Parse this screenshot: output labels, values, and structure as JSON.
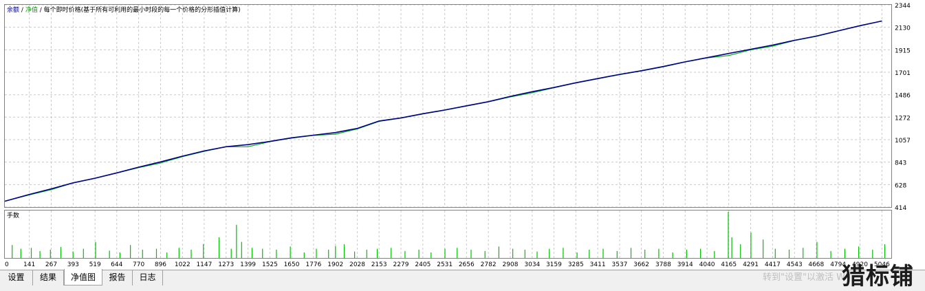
{
  "legend": {
    "balance": "余额",
    "sep1": "/",
    "equity": "净值",
    "sep2": "/",
    "description": "每个即时价格(基于所有可利用的最小时段的每一个价格的分形插值计算)"
  },
  "volume_panel_label": "手数",
  "tabs": [
    {
      "label": "设置",
      "active": false
    },
    {
      "label": "结果",
      "active": false
    },
    {
      "label": "净值图",
      "active": true
    },
    {
      "label": "报告",
      "active": false
    },
    {
      "label": "日志",
      "active": false
    }
  ],
  "watermark": {
    "text": "转到\"设置\"以激活 W",
    "logo": "猎标铺"
  },
  "colors": {
    "balance_line": "#00008b",
    "equity_line": "#00aa00",
    "volume_bars": "#00c000",
    "grid": "#c8c8c8"
  },
  "chart_data": [
    {
      "type": "line",
      "series": [
        {
          "name": "余额",
          "x": [
            0,
            141,
            267,
            393,
            519,
            644,
            770,
            896,
            1022,
            1147,
            1273,
            1399,
            1525,
            1650,
            1776,
            1902,
            2028,
            2153,
            2279,
            2405,
            2531,
            2656,
            2782,
            2908,
            3034,
            3159,
            3285,
            3411,
            3537,
            3662,
            3788,
            3914,
            4040,
            4165,
            4291,
            4417,
            4543,
            4668,
            4794,
            4920,
            5046
          ],
          "values": [
            470,
            535,
            588,
            645,
            690,
            740,
            795,
            845,
            900,
            950,
            990,
            1010,
            1040,
            1075,
            1100,
            1125,
            1165,
            1235,
            1265,
            1305,
            1340,
            1380,
            1420,
            1470,
            1515,
            1555,
            1600,
            1640,
            1680,
            1715,
            1755,
            1800,
            1840,
            1880,
            1920,
            1960,
            2005,
            2045,
            2095,
            2145,
            2190
          ]
        },
        {
          "name": "净值",
          "x": [
            0,
            141,
            267,
            393,
            519,
            644,
            770,
            896,
            1022,
            1147,
            1273,
            1399,
            1525,
            1650,
            1776,
            1902,
            2028,
            2153,
            2279,
            2405,
            2531,
            2656,
            2782,
            2908,
            3034,
            3159,
            3285,
            3411,
            3537,
            3662,
            3788,
            3914,
            4040,
            4165,
            4291,
            4417,
            4543,
            4668,
            4794,
            4920,
            5046
          ],
          "values": [
            470,
            530,
            580,
            645,
            688,
            738,
            790,
            835,
            895,
            945,
            990,
            990,
            1038,
            1072,
            1098,
            1110,
            1160,
            1232,
            1263,
            1302,
            1338,
            1378,
            1418,
            1465,
            1505,
            1552,
            1598,
            1638,
            1678,
            1713,
            1752,
            1798,
            1838,
            1860,
            1915,
            1950,
            2003,
            2043,
            2093,
            2143,
            2190
          ]
        }
      ],
      "y_ticks": [
        414,
        628,
        843,
        1057,
        1272,
        1486,
        1701,
        1915,
        2130,
        2344
      ],
      "ylim": [
        414,
        2344
      ],
      "xlim": [
        0,
        5100
      ],
      "grid": true
    },
    {
      "type": "bar",
      "title": "手数",
      "x_ticks": [
        0,
        141,
        267,
        393,
        519,
        644,
        770,
        896,
        1022,
        1147,
        1273,
        1399,
        1525,
        1650,
        1776,
        1902,
        2028,
        2153,
        2279,
        2405,
        2531,
        2656,
        2782,
        2908,
        3034,
        3159,
        3285,
        3411,
        3537,
        3662,
        3788,
        3914,
        4040,
        4165,
        4291,
        4417,
        4543,
        4668,
        4794,
        4920,
        5046
      ],
      "x": [
        40,
        90,
        150,
        200,
        260,
        320,
        390,
        450,
        520,
        600,
        660,
        720,
        790,
        870,
        930,
        1000,
        1070,
        1140,
        1230,
        1300,
        1330,
        1360,
        1420,
        1480,
        1560,
        1640,
        1720,
        1790,
        1860,
        1900,
        1950,
        2010,
        2080,
        2140,
        2220,
        2300,
        2380,
        2450,
        2530,
        2600,
        2680,
        2760,
        2840,
        2920,
        2990,
        3060,
        3130,
        3210,
        3290,
        3360,
        3440,
        3520,
        3600,
        3680,
        3760,
        3840,
        3920,
        4000,
        4080,
        4160,
        4180,
        4230,
        4290,
        4360,
        4430,
        4510,
        4590,
        4670,
        4750,
        4830,
        4910,
        4990,
        5060
      ],
      "values": [
        0.28,
        0.2,
        0.22,
        0.15,
        0.18,
        0.24,
        0.14,
        0.2,
        0.35,
        0.16,
        0.12,
        0.28,
        0.18,
        0.2,
        0.12,
        0.22,
        0.18,
        0.3,
        0.45,
        0.2,
        0.72,
        0.35,
        0.22,
        0.2,
        0.18,
        0.25,
        0.12,
        0.2,
        0.18,
        0.26,
        0.3,
        0.14,
        0.18,
        0.2,
        0.22,
        0.15,
        0.18,
        0.12,
        0.2,
        0.22,
        0.18,
        0.15,
        0.25,
        0.2,
        0.18,
        0.14,
        0.2,
        0.22,
        0.12,
        0.18,
        0.2,
        0.15,
        0.22,
        0.18,
        0.2,
        0.12,
        0.18,
        0.2,
        0.15,
        1.0,
        0.45,
        0.3,
        0.55,
        0.4,
        0.2,
        0.18,
        0.22,
        0.35,
        0.15,
        0.2,
        0.25,
        0.18,
        0.3
      ],
      "ylim": [
        0,
        1
      ]
    }
  ]
}
